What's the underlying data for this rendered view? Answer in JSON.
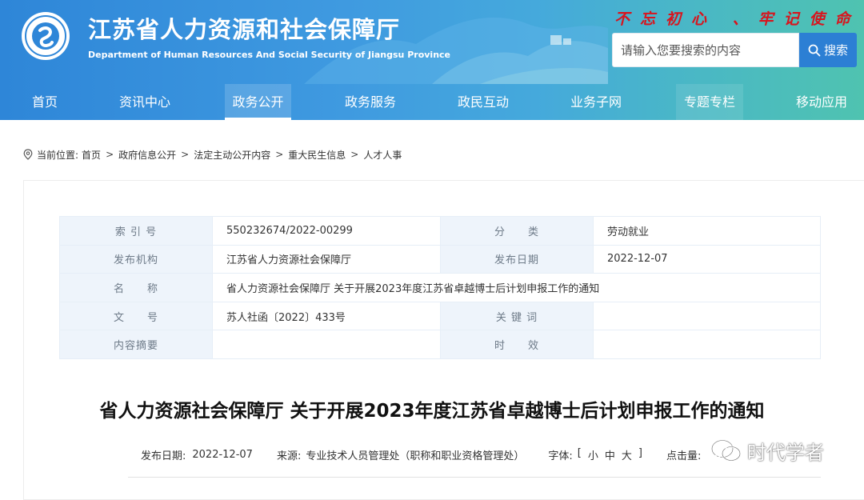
{
  "header": {
    "title": "江苏省人力资源和社会保障厅",
    "subtitle": "Department of Human Resources And Social Security of Jiangsu Province",
    "slogan": "不忘初心 、牢记使命"
  },
  "search": {
    "placeholder": "请输入您要搜索的内容",
    "button_label": "搜索"
  },
  "nav": {
    "items": [
      "首页",
      "资讯中心",
      "政务公开",
      "政务服务",
      "政民互动",
      "业务子网",
      "专题专栏",
      "移动应用"
    ],
    "active": "政务公开"
  },
  "breadcrumb": {
    "prefix": "当前位置:",
    "items": [
      "首页",
      "政府信息公开",
      "法定主动公开内容",
      "重大民生信息",
      "人才人事"
    ]
  },
  "meta": {
    "index_label": "索 引 号",
    "index_value": "550232674/2022-00299",
    "category_label": "分　　类",
    "category_value": "劳动就业",
    "publisher_label": "发布机构",
    "publisher_value": "江苏省人力资源社会保障厅",
    "date_label": "发布日期",
    "date_value": "2022-12-07",
    "name_label": "名　　称",
    "name_value": "省人力资源社会保障厅 关于开展2023年度江苏省卓越博士后计划申报工作的通知",
    "doc_label": "文　　号",
    "doc_value": "苏人社函〔2022〕433号",
    "keywords_label": "关 键 词",
    "keywords_value": "",
    "abstract_label": "内容摘要",
    "abstract_value": "",
    "validity_label": "时　　效",
    "validity_value": ""
  },
  "article": {
    "title": "省人力资源社会保障厅 关于开展2023年度江苏省卓越博士后计划申报工作的通知",
    "date_label": "发布日期:",
    "date": "2022-12-07",
    "source_label": "来源:",
    "source": "专业技术人员管理处（职称和职业资格管理处）",
    "font_label": "字体:",
    "font_open": "[",
    "font_small": "小",
    "font_medium": "中",
    "font_large": "大",
    "font_close": "]",
    "hits_label": "点击量:"
  },
  "watermark": {
    "text": "时代学者"
  },
  "colors": {
    "header_start": "#2e86d8",
    "header_end": "#4fc3b0",
    "slogan": "#d8141d",
    "search_button": "#2c7fd4",
    "label_cell_bg": "#eef4fb"
  }
}
